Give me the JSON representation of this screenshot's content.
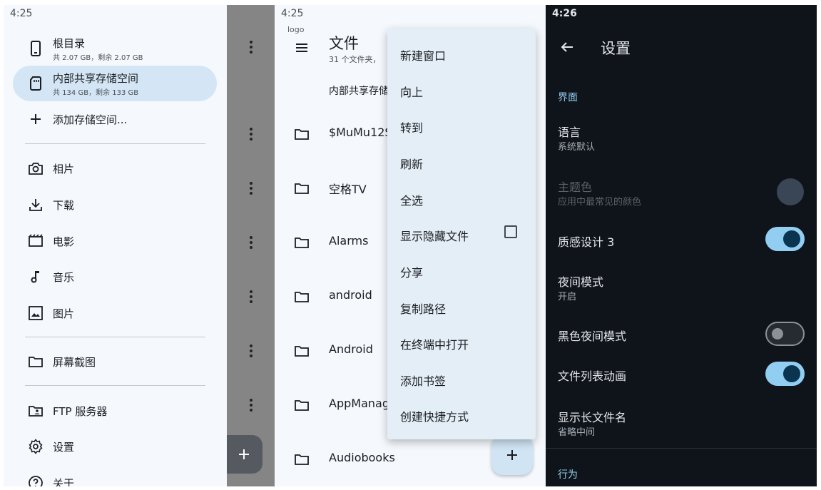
{
  "drawer": {
    "time": "4:25",
    "drives": [
      {
        "title": "根目录",
        "sub": "共 2.07 GB，剩余 2.07 GB"
      },
      {
        "title": "内部共享存储空间",
        "sub": "共 134 GB，剩余 133 GB"
      }
    ],
    "add_storage": "添加存储空间...",
    "bookmarks": [
      "相片",
      "下载",
      "电影",
      "音乐",
      "图片"
    ],
    "screenshots": "屏幕截图",
    "ftp": "FTP 服务器",
    "settings": "设置",
    "about": "关于"
  },
  "files": {
    "time": "4:25",
    "logo": "logo",
    "title": "文件",
    "subtitle": "31 个文件夹，",
    "breadcrumb": "内部共享存储",
    "items": [
      "$MuMu12S",
      "空格TV",
      "Alarms",
      "android",
      "Android",
      "AppManag",
      "Audiobooks"
    ]
  },
  "menu": {
    "items": [
      "新建窗口",
      "向上",
      "转到",
      "刷新",
      "全选",
      "显示隐藏文件",
      "分享",
      "复制路径",
      "在终端中打开",
      "添加书签",
      "创建快捷方式"
    ],
    "show_hidden_checked": false
  },
  "settings": {
    "time": "4:26",
    "title": "设置",
    "section_interface": "界面",
    "language": {
      "title": "语言",
      "value": "系统默认"
    },
    "theme_color": {
      "title": "主题色",
      "value": "应用中最常见的颜色",
      "color": "#3a4556"
    },
    "material3": {
      "title": "质感设计 3",
      "on": true
    },
    "night_mode": {
      "title": "夜间模式",
      "value": "开启"
    },
    "black_night": {
      "title": "黑色夜间模式",
      "on": false
    },
    "list_anim": {
      "title": "文件列表动画",
      "on": true
    },
    "long_names": {
      "title": "显示长文件名",
      "value": "省略中间"
    },
    "section_behavior": "行为"
  },
  "colors": {
    "accent": "#92cdf2",
    "selected_drive": "#d4e6f5",
    "dark_bg": "#0f141a"
  }
}
